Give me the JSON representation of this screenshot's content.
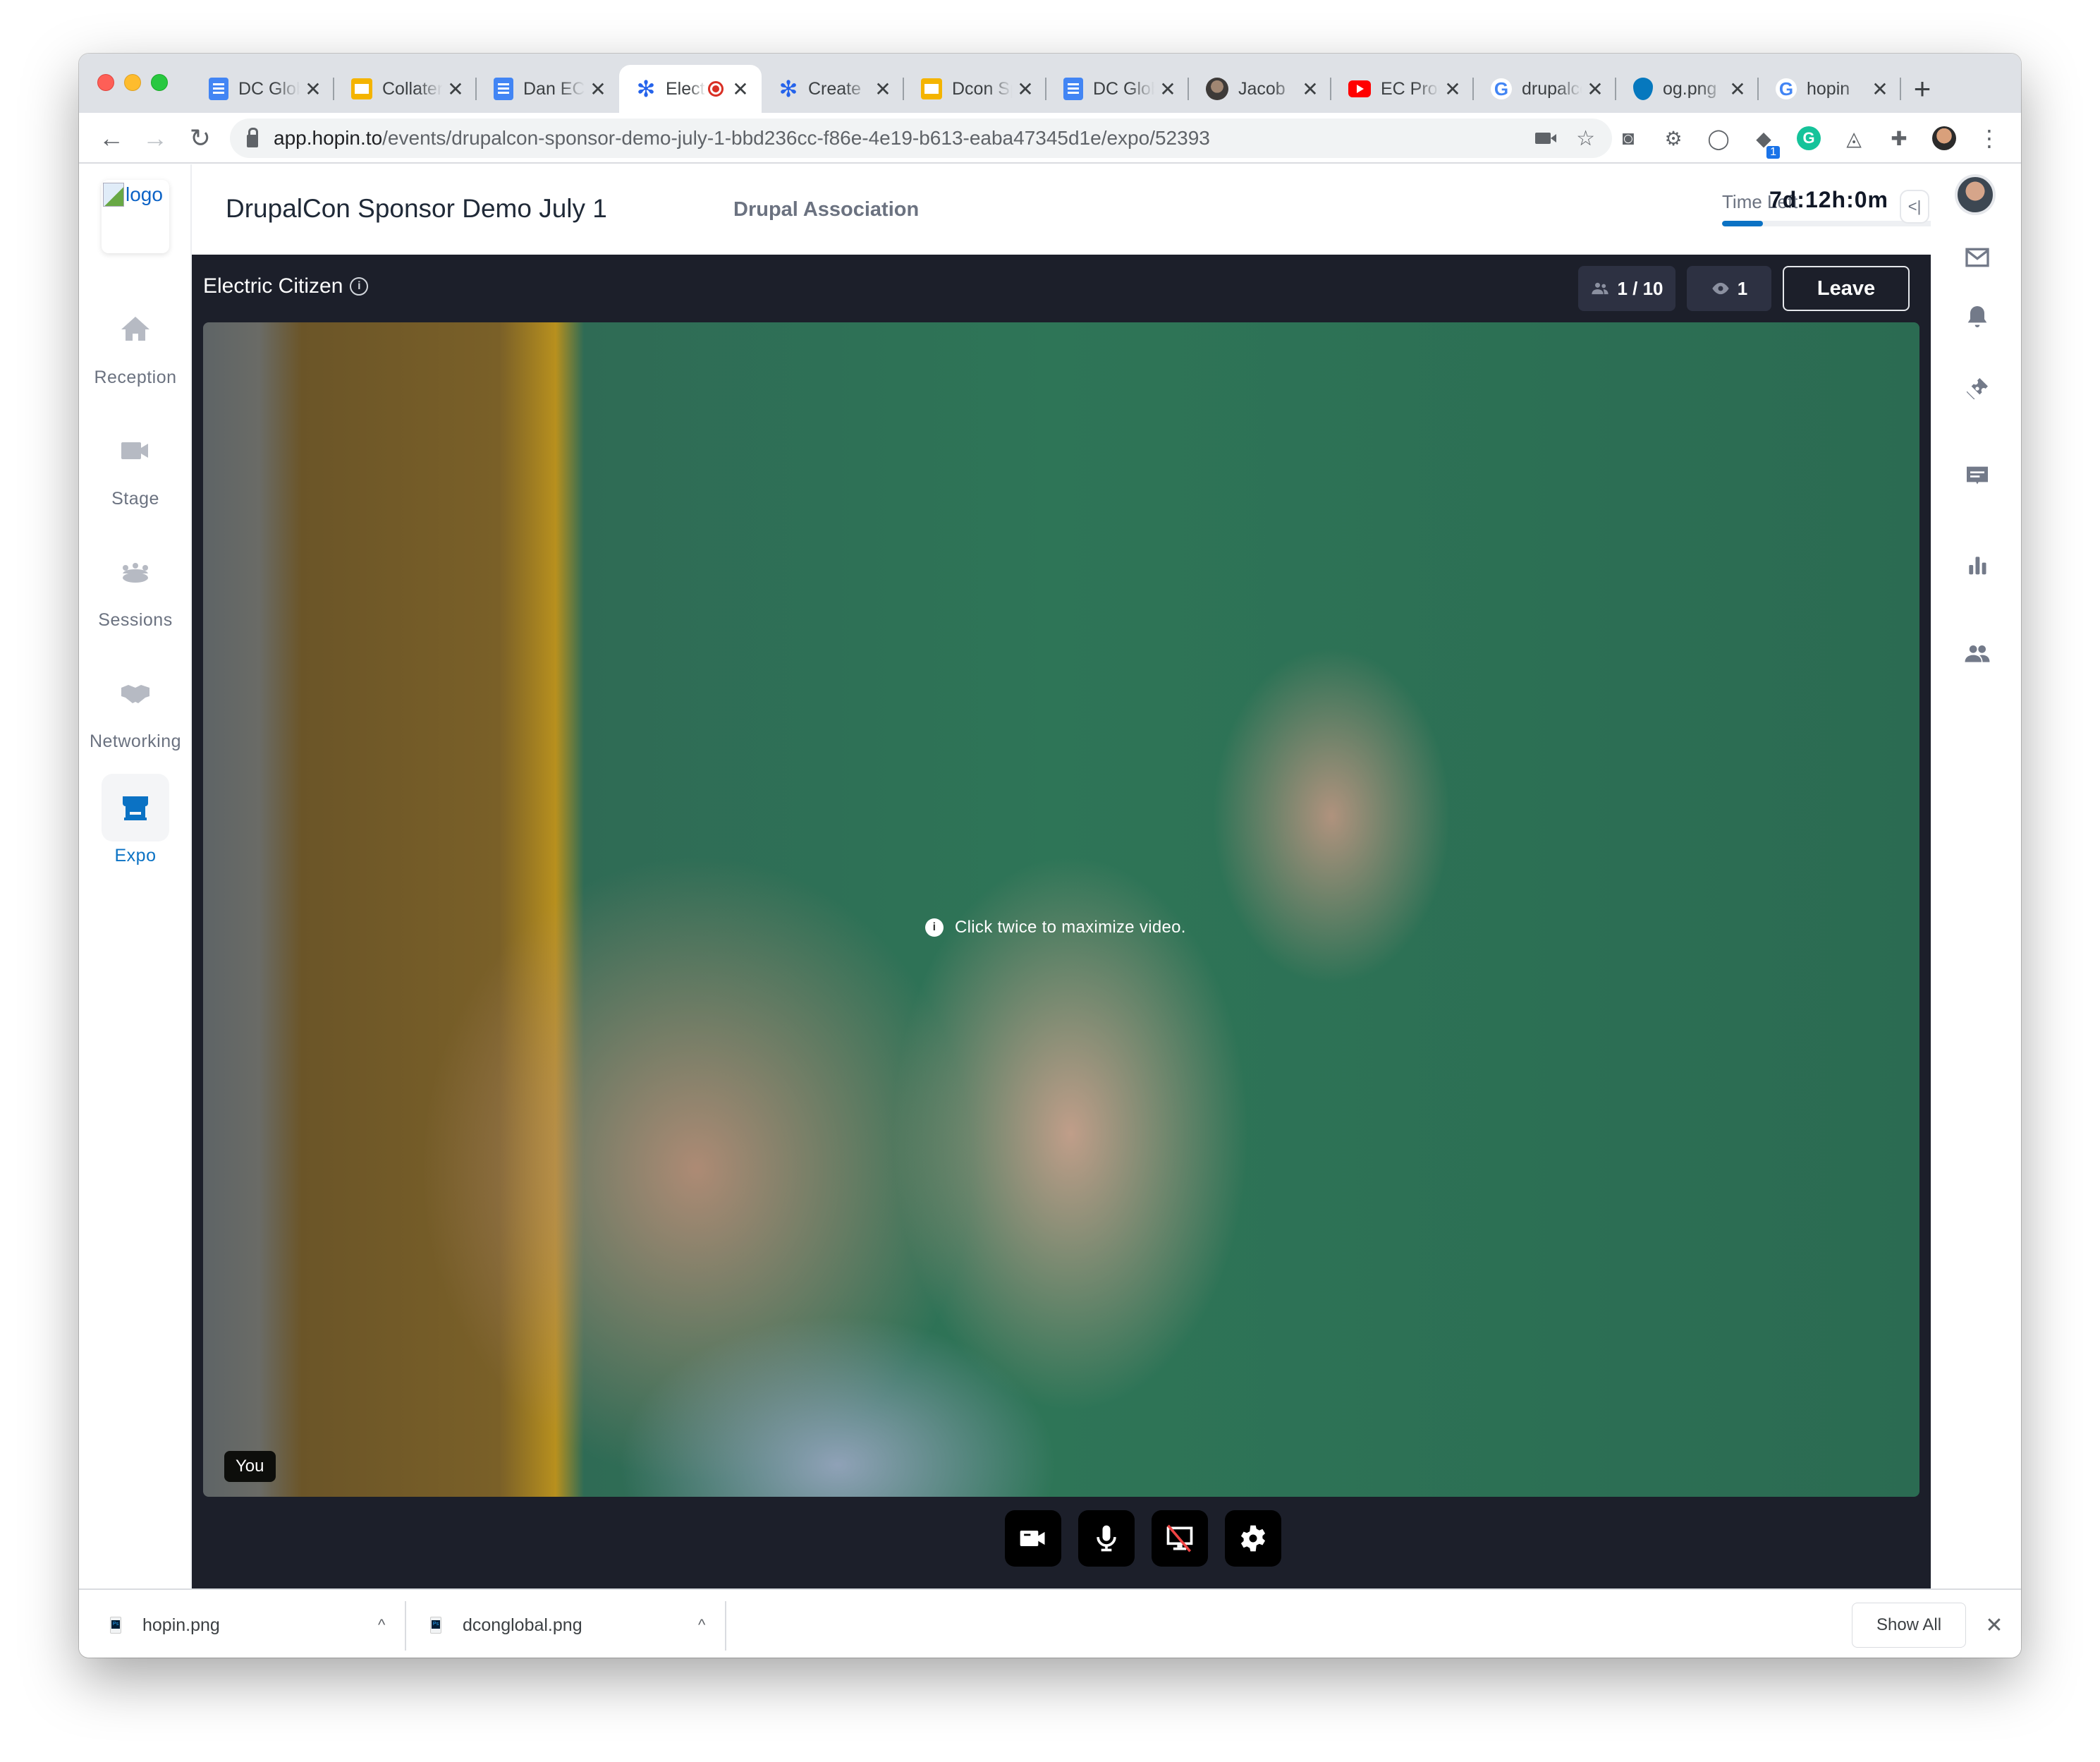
{
  "browser": {
    "tabs": [
      {
        "label": "DC Global",
        "favicon": "google-docs-icon"
      },
      {
        "label": "Collateral",
        "favicon": "google-slides-icon"
      },
      {
        "label": "Dan EC",
        "favicon": "google-docs-icon"
      },
      {
        "label": "Electric Citizen",
        "favicon": "hopin-icon",
        "active": true,
        "recording": true
      },
      {
        "label": "Create",
        "favicon": "hopin-icon"
      },
      {
        "label": "Dcon Sponsor",
        "favicon": "google-slides-icon"
      },
      {
        "label": "DC Global",
        "favicon": "google-docs-icon"
      },
      {
        "label": "Jacob",
        "favicon": "avatar-icon"
      },
      {
        "label": "EC Promo",
        "favicon": "youtube-icon"
      },
      {
        "label": "drupalcon",
        "favicon": "google-icon"
      },
      {
        "label": "og.png",
        "favicon": "drupal-icon"
      },
      {
        "label": "hopin",
        "favicon": "google-icon"
      }
    ],
    "tab_close_glyph": "✕",
    "new_tab_glyph": "+",
    "url_host": "app.hopin.to",
    "url_path": "/events/drupalcon-sponsor-demo-july-1-bbd236cc-f86e-4e19-b613-eaba47345d1e/expo/52393",
    "extension_badge": "1",
    "grammarly_letter": "G"
  },
  "app": {
    "logo_alt": "logo",
    "nav": [
      {
        "label": "Reception",
        "icon": "home-icon"
      },
      {
        "label": "Stage",
        "icon": "video-camera-icon"
      },
      {
        "label": "Sessions",
        "icon": "group-table-icon"
      },
      {
        "label": "Networking",
        "icon": "handshake-icon"
      },
      {
        "label": "Expo",
        "icon": "booth-icon",
        "active": true
      }
    ],
    "header": {
      "event_title": "DrupalCon Sponsor Demo July 1",
      "organizer": "Drupal Association",
      "time_left_label": "Time Left",
      "time_left_value": "7d:12h:0m",
      "time_progress_percent": 16,
      "collapse_glyph": "<|"
    },
    "room": {
      "title": "Electric Citizen",
      "participants": "1 / 10",
      "viewers": "1",
      "leave_label": "Leave",
      "video_hint": "Click twice to maximize video.",
      "self_label": "You"
    },
    "controls": [
      {
        "name": "camera-toggle",
        "icon": "video-camera-icon"
      },
      {
        "name": "microphone-toggle",
        "icon": "microphone-icon"
      },
      {
        "name": "screen-share-toggle",
        "icon": "screen-share-off-icon"
      },
      {
        "name": "settings",
        "icon": "gear-icon"
      }
    ],
    "right_sidebar": [
      "mail-icon",
      "bell-icon",
      "ticket-icon",
      "chat-icon",
      "poll-chart-icon",
      "people-icon"
    ]
  },
  "downloads": {
    "items": [
      {
        "filename": "hopin.png"
      },
      {
        "filename": "dconglobal.png"
      }
    ],
    "show_all_label": "Show All",
    "close_glyph": "✕",
    "caret_glyph": "^"
  },
  "colors": {
    "accent": "#0b72c4",
    "room_bg": "#1c1f2a",
    "pill_bg": "#2d3142",
    "nav_icon_inactive": "#b6bac3",
    "rec_red": "#d93025"
  }
}
